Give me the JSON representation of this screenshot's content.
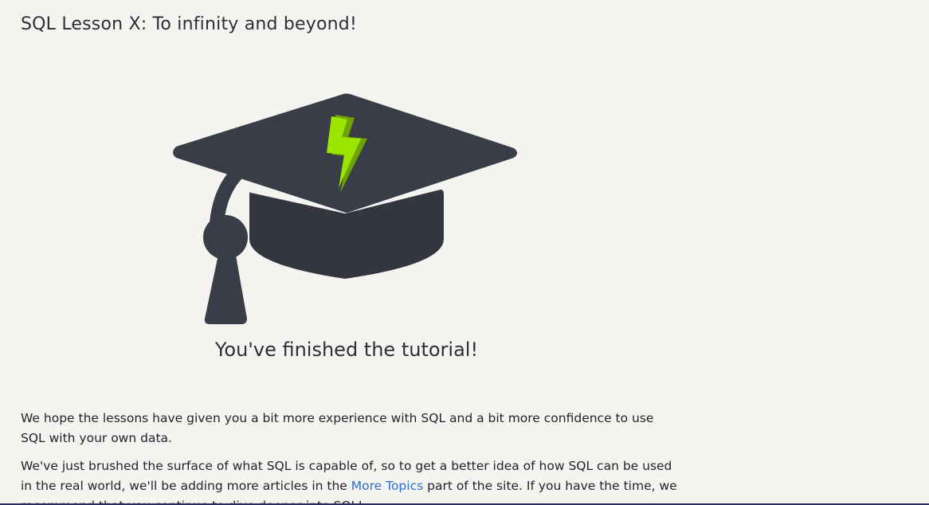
{
  "page": {
    "title": "SQL Lesson X: To infinity and beyond!",
    "finish_message": "You've finished the tutorial!"
  },
  "hero": {
    "icon": "graduation-cap-icon",
    "accent_icon": "lightning-bolt-icon",
    "cap_color": "#393d47",
    "bolt_color": "#9be500"
  },
  "content": {
    "paragraph_1": "We hope the lessons have given you a bit more experience with SQL and a bit more confidence to use SQL with your own data.",
    "paragraph_2_before_link": "We've just brushed the surface of what SQL is capable of, so to get a better idea of how SQL can be used in the real world, we'll be adding more articles in the ",
    "paragraph_2_link": "More Topics",
    "paragraph_2_after_link": " part of the site. If you have the time, we recommend that you continue to dive deeper into SQL!"
  },
  "colors": {
    "background": "#f5f4f1",
    "link": "#2f6fd1",
    "text": "#1f2328"
  }
}
